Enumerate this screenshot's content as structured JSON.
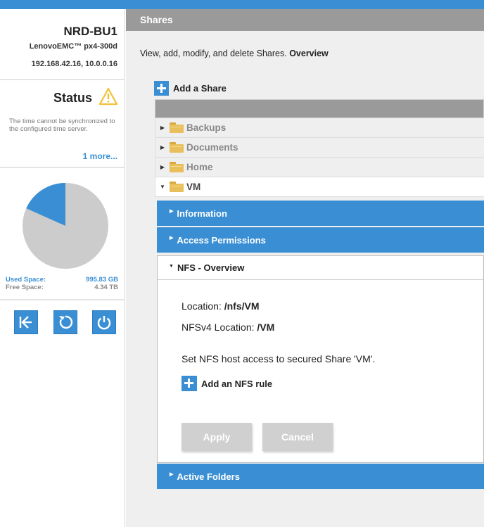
{
  "device": {
    "name": "NRD-BU1",
    "model": "LenovoEMC™ px4-300d",
    "ip": "192.168.42.16, 10.0.0.16"
  },
  "status": {
    "title": "Status",
    "message": "The time cannot be synchronized to the configured time server.",
    "more_link": "1 more..."
  },
  "storage": {
    "used_label": "Used Space:",
    "used_value": "995.83 GB",
    "free_label": "Free Space:",
    "free_value": "4.34 TB",
    "used_fraction": 0.183,
    "used_color": "#3a8fd4",
    "free_color": "#cccccc"
  },
  "actions": [
    {
      "icon": "back-arrow-icon"
    },
    {
      "icon": "restart-icon"
    },
    {
      "icon": "power-icon"
    }
  ],
  "main": {
    "header": "Shares",
    "intro_text": "View, add, modify, and delete Shares.",
    "intro_link": "Overview",
    "add_share_label": "Add a Share",
    "shares": [
      {
        "name": "Backups",
        "expanded": false
      },
      {
        "name": "Documents",
        "expanded": false
      },
      {
        "name": "Home",
        "expanded": false
      },
      {
        "name": "VM",
        "expanded": true
      }
    ],
    "sections": {
      "information": "Information",
      "access": "Access Permissions",
      "nfs": "NFS - Overview",
      "active": "Active Folders"
    },
    "nfs": {
      "location_label": "Location:",
      "location_value": "/nfs/VM",
      "nfsv4_label": "NFSv4 Location:",
      "nfsv4_value": "/VM",
      "secure_text": "Set NFS host access to secured Share 'VM'.",
      "add_rule_label": "Add an NFS rule",
      "apply_label": "Apply",
      "cancel_label": "Cancel"
    }
  },
  "colors": {
    "accent": "#3a8fd4",
    "header_gray": "#9a9a9a",
    "warning": "#f0c23b"
  }
}
